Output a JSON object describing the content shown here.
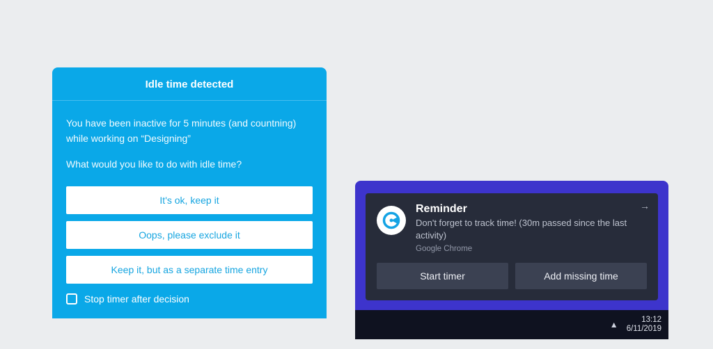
{
  "idle": {
    "title": "Idle time detected",
    "message": "You have been inactive for 5 minutes (and countning) while working on “Designing”",
    "question": "What would you like to do with idle time?",
    "buttons": {
      "keep": "It's ok, keep it",
      "exclude": "Oops, please exclude it",
      "separate": "Keep it, but as a separate time entry"
    },
    "checkbox_label": "Stop timer after decision"
  },
  "reminder": {
    "title": "Reminder",
    "body": "Don't forget to track time! (30m passed since the last activity)",
    "source": "Google Chrome",
    "buttons": {
      "start": "Start timer",
      "add": "Add missing time"
    }
  },
  "taskbar": {
    "time": "13:12",
    "date": "6/11/2019"
  },
  "colors": {
    "idle_bg": "#0aa8e8",
    "notif_wrap": "#3d34cc",
    "toast_bg": "#272c3a",
    "taskbar_bg": "#0f1220"
  }
}
